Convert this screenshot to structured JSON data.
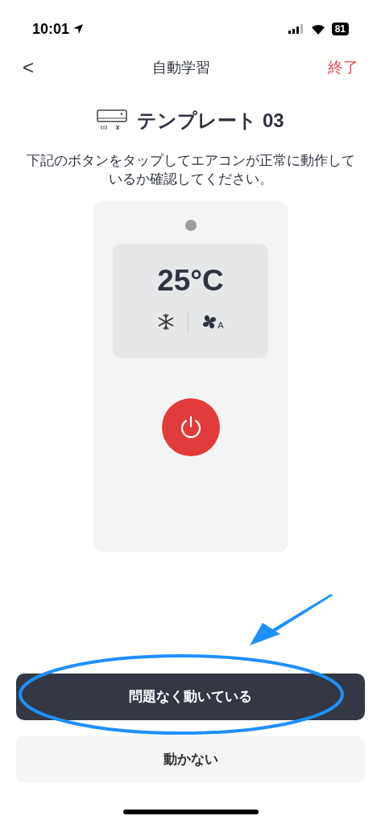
{
  "status_bar": {
    "time": "10:01",
    "battery": "81"
  },
  "nav": {
    "back": "<",
    "title": "自動学習",
    "action": "終了"
  },
  "header": {
    "title": "テンプレート 03"
  },
  "description": "下記のボタンをタップしてエアコンが正常に動作しているか確認してください。",
  "remote": {
    "temperature": "25°C",
    "fan_mode": "A"
  },
  "buttons": [
    {
      "label": "問題なく動いている",
      "kind": "primary"
    },
    {
      "label": "動かない",
      "kind": "secondary"
    }
  ]
}
